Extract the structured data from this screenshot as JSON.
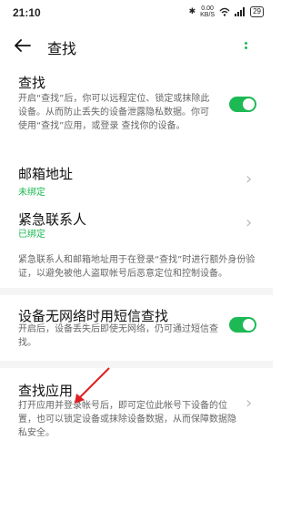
{
  "status_bar": {
    "time": "21:10",
    "speed_value": "0.00",
    "speed_unit": "KB/S",
    "battery": "29"
  },
  "header": {
    "title": "查找"
  },
  "find": {
    "title": "查找",
    "description": "开启“查找”后，你可以远程定位、锁定或抹除此设备。从而防止丢失的设备泄露隐私数据。你可使用“查找”应用，或登录                    查找你的设备。",
    "toggle_on": true
  },
  "email": {
    "title": "邮箱地址",
    "status": "未绑定"
  },
  "emergency": {
    "title": "紧急联系人",
    "status": "已绑定"
  },
  "emergency_note": "紧急联系人和邮箱地址用于在登录“查找”时进行额外身份验证，以避免被他人盗取帐号后恶意定位和控制设备。",
  "sms_find": {
    "title": "设备无网络时用短信查找",
    "description": "开启后，设备丢失后即使无网络，仍可通过短信查找。",
    "toggle_on": true
  },
  "find_app": {
    "title": "查找应用",
    "description": "打开应用并登录帐号后，即可定位此帐号下设备的位置，也可以锁定设备或抹除设备数据，从而保障数据隐私安全。"
  },
  "colors": {
    "accent": "#1db954",
    "annotation_arrow": "#e02020"
  }
}
